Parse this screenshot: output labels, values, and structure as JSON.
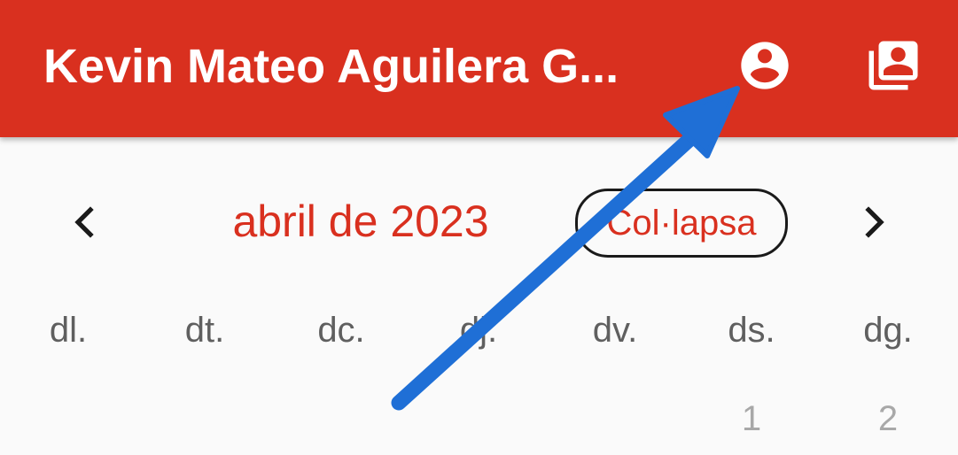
{
  "app_bar": {
    "title": "Kevin Mateo Aguilera G...",
    "actions": [
      {
        "icon": "account-circle-icon"
      },
      {
        "icon": "contacts-stack-icon"
      }
    ]
  },
  "calendar": {
    "month_label": "abril de 2023",
    "collapse_label": "Col·lapsa",
    "prev_icon": "chevron-left-icon",
    "next_icon": "chevron-right-icon",
    "weekdays": [
      "dl.",
      "dt.",
      "dc.",
      "dj.",
      "dv.",
      "ds.",
      "dg."
    ],
    "first_row_days": [
      "1",
      "2"
    ]
  },
  "colors": {
    "app_bar": "#d9301f",
    "accent": "#d9301f",
    "annotation_arrow": "#1f6fd6",
    "background": "#fafafa"
  },
  "annotation": {
    "type": "arrow",
    "points_to": "account-circle-icon"
  }
}
